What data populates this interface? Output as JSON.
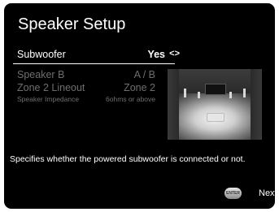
{
  "screen": {
    "title": "Speaker Setup",
    "settings": [
      {
        "label": "Subwoofer",
        "value": "Yes",
        "arrows": "<>"
      },
      {
        "label": "Speaker B",
        "value": "A / B"
      },
      {
        "label": "Zone 2 Lineout",
        "value": "Zone 2"
      },
      {
        "label": "Speaker Impedance",
        "value": "6ohms or above"
      }
    ],
    "description": "Specifies whether the powered subwoofer is connected or not.",
    "footer": {
      "enter_label": "ENTER",
      "next_label": "Next"
    }
  },
  "colors": {
    "background": "#000000",
    "text": "#ffffff",
    "disabled_text": "#6e6e6e"
  }
}
